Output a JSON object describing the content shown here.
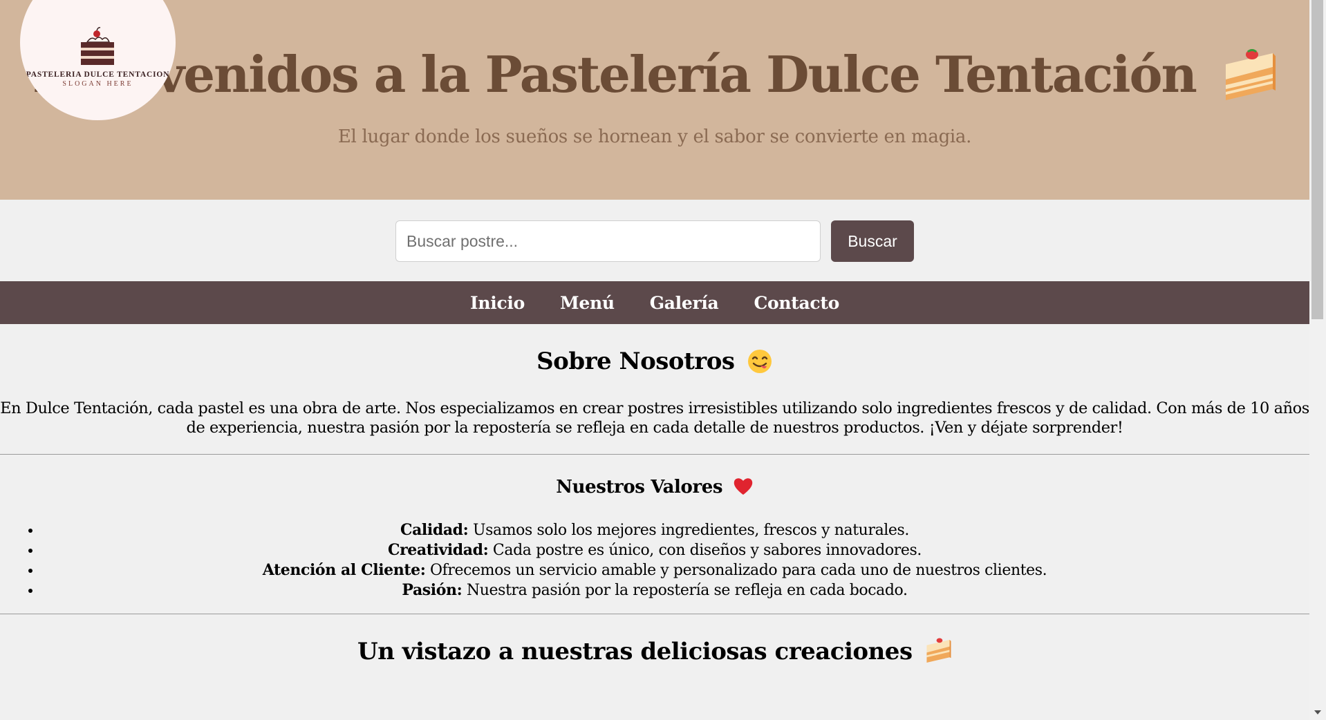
{
  "header": {
    "logo": {
      "name": "PASTELERIA DULCE TENTACION",
      "slogan": "SLOGAN HERE"
    },
    "title": "Bienvenidos a la Pastelería Dulce Tentación",
    "title_icon": "shortcake-icon",
    "subtitle": "El lugar donde los sueños se hornean y el sabor se convierte en magia."
  },
  "search": {
    "placeholder": "Buscar postre...",
    "value": "",
    "button_label": "Buscar"
  },
  "nav": {
    "items": [
      {
        "label": "Inicio"
      },
      {
        "label": "Menú"
      },
      {
        "label": "Galería"
      },
      {
        "label": "Contacto"
      }
    ]
  },
  "about": {
    "heading": "Sobre Nosotros",
    "heading_icon": "yum-face-icon",
    "text": "En Dulce Tentación, cada pastel es una obra de arte. Nos especializamos en crear postres irresistibles utilizando solo ingredientes frescos y de calidad. Con más de 10 años de experiencia, nuestra pasión por la repostería se refleja en cada detalle de nuestros productos. ¡Ven y déjate sorprender!"
  },
  "values": {
    "heading": "Nuestros Valores",
    "heading_icon": "red-heart-icon",
    "items": [
      {
        "term": "Calidad:",
        "desc": " Usamos solo los mejores ingredientes, frescos y naturales."
      },
      {
        "term": "Creatividad:",
        "desc": " Cada postre es único, con diseños y sabores innovadores."
      },
      {
        "term": "Atención al Cliente:",
        "desc": " Ofrecemos un servicio amable y personalizado para cada uno de nuestros clientes."
      },
      {
        "term": "Pasión:",
        "desc": " Nuestra pasión por la repostería se refleja en cada bocado."
      }
    ]
  },
  "gallery": {
    "heading": "Un vistazo a nuestras deliciosas creaciones",
    "heading_icon": "shortcake-icon"
  },
  "colors": {
    "header_bg": "#d2b69c",
    "title": "#6b4c36",
    "accent_dark": "#5c494b",
    "page_bg": "#f0f0f0"
  }
}
